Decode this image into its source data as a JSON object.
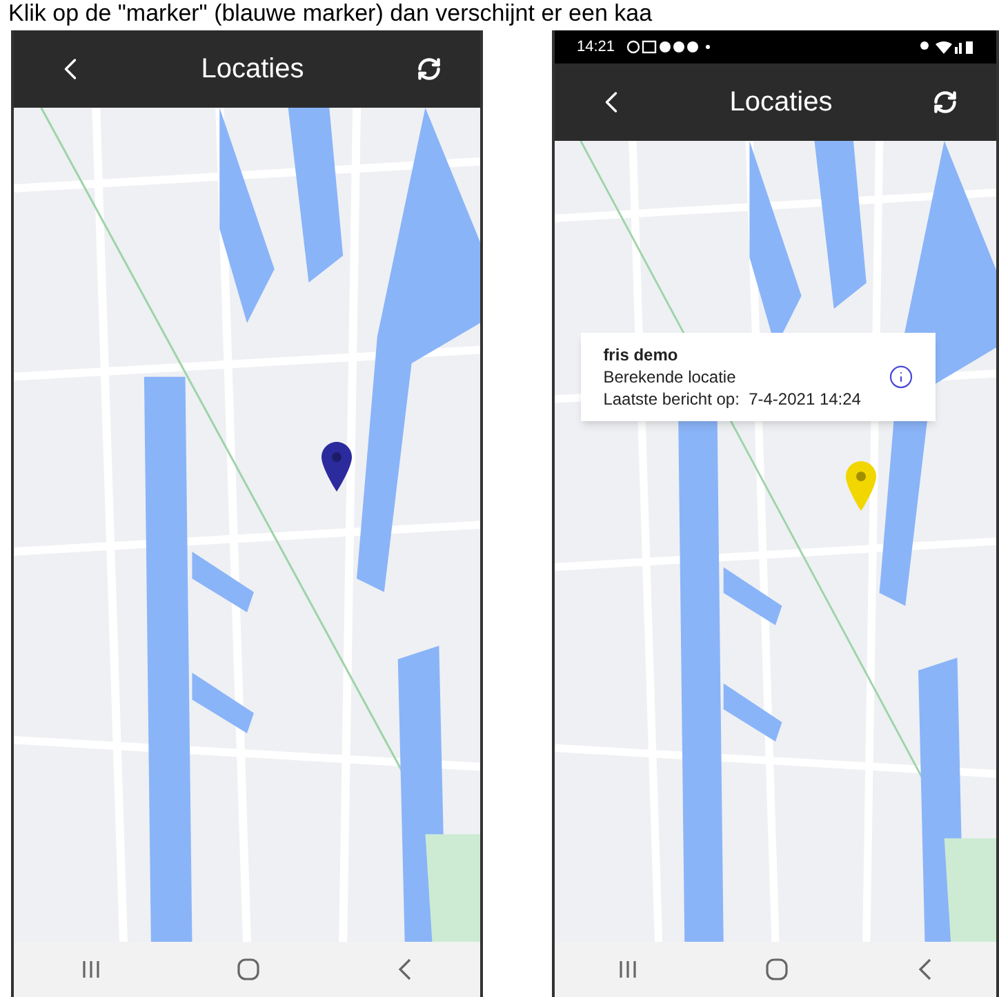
{
  "caption": "Klik op de \"marker\" (blauwe marker) dan verschijnt er een kaa",
  "phones": [
    {
      "app_bar": {
        "title": "Locaties"
      },
      "marker": {
        "color": "#2b2b9e"
      }
    },
    {
      "status_bar": {
        "time": "14:21"
      },
      "app_bar": {
        "title": "Locaties"
      },
      "marker": {
        "color": "#f2d600"
      },
      "info_window": {
        "title": "fris demo",
        "line_1": "Berekende locatie",
        "line_2": "Laatste bericht op:  7-4-2021 14:24"
      }
    }
  ]
}
